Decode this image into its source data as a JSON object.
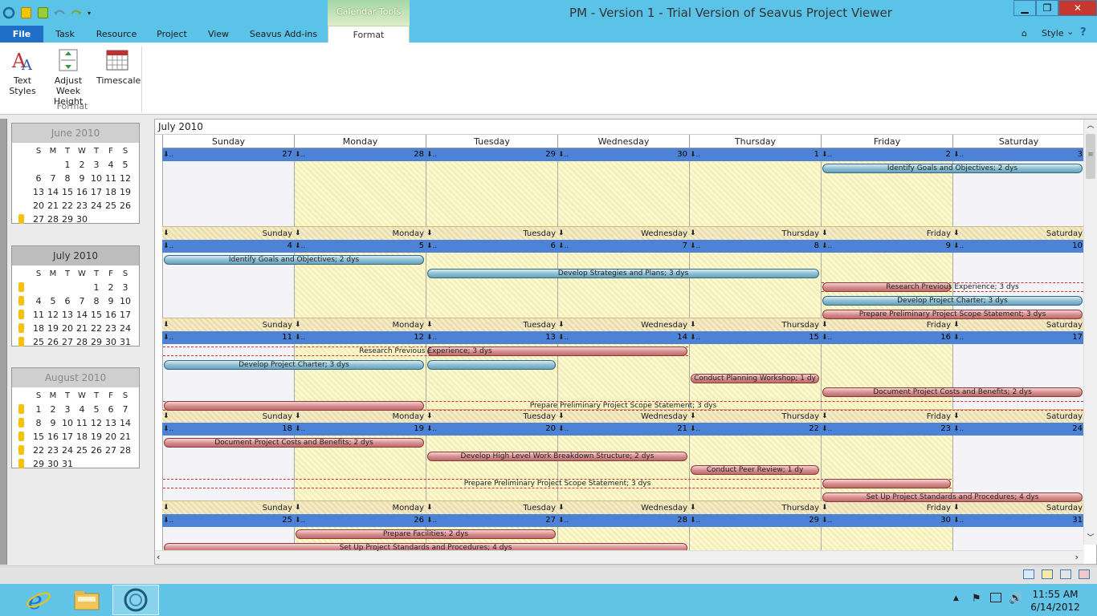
{
  "window": {
    "title": "PM - Version 1 - Trial Version of Seavus Project Viewer",
    "context_tab_group": "Calendar Tools",
    "minimize_glyph": "▁",
    "restore_glyph": "❐",
    "close_glyph": "✕"
  },
  "ribbon": {
    "tabs": [
      "File",
      "Task",
      "Resource",
      "Project",
      "View",
      "Seavus Add-ins",
      "Format"
    ],
    "style_label": "Style",
    "style_caret": "⌄",
    "help_glyph": "?",
    "buttons": [
      {
        "label": "Text Styles",
        "icon": "text-styles-icon"
      },
      {
        "label": "Adjust Week Height",
        "icon": "adjust-week-height-icon"
      },
      {
        "label": "Timescale",
        "icon": "timescale-icon"
      }
    ],
    "group_label": "Format"
  },
  "mini_calendars": {
    "day_headers": [
      "S",
      "M",
      "T",
      "W",
      "T",
      "F",
      "S"
    ],
    "months": [
      {
        "title": "June 2010",
        "current": false,
        "lead": 2,
        "days": 30
      },
      {
        "title": "July 2010",
        "current": true,
        "lead": 4,
        "days": 31
      },
      {
        "title": "August 2010",
        "current": false,
        "lead": 0,
        "days": 31
      }
    ]
  },
  "calendar": {
    "month_label": "July 2010",
    "day_names": [
      "Sunday",
      "Monday",
      "Tuesday",
      "Wednesday",
      "Thursday",
      "Friday",
      "Saturday"
    ],
    "weeks": [
      {
        "dates": [
          "27",
          "28",
          "29",
          "30",
          "1",
          "2",
          "3"
        ],
        "tasks": [
          {
            "name": "Identify Goals and Objectives; 2 dys",
            "start": 5,
            "span": 2,
            "row": 0,
            "style": "blue"
          }
        ]
      },
      {
        "dates": [
          "4",
          "5",
          "6",
          "7",
          "8",
          "9",
          "10"
        ],
        "tasks": [
          {
            "name": "Identify Goals and Objectives; 2 dys",
            "start": 0,
            "span": 2,
            "row": 0,
            "style": "blue"
          },
          {
            "name": "Develop Strategies and Plans; 3 dys",
            "start": 2,
            "span": 3,
            "row": 1,
            "style": "blue"
          },
          {
            "name": "Research Previous Experience; 3 dys",
            "start": 5,
            "span": 1,
            "row": 2,
            "style": "red",
            "dash_span": 2
          },
          {
            "name": "Develop Project Charter; 3 dys",
            "start": 5,
            "span": 2,
            "row": 3,
            "style": "blue"
          },
          {
            "name": "Prepare Preliminary Project Scope Statement; 3 dys",
            "start": 5,
            "span": 2,
            "row": 4,
            "style": "red"
          }
        ]
      },
      {
        "dates": [
          "11",
          "12",
          "13",
          "14",
          "15",
          "16",
          "17"
        ],
        "tasks": [
          {
            "name": "Research Previous Experience; 3 dys",
            "start": 2,
            "span": 2,
            "row": 0,
            "style": "red",
            "dash_from": 0
          },
          {
            "name": "Develop Project Charter; 3 dys",
            "start": 0,
            "span": 2,
            "row": 1,
            "style": "blue",
            "extra_start": 2,
            "extra_span": 1
          },
          {
            "name": "Conduct Planning Workshop; 1 dy",
            "start": 4,
            "span": 1,
            "row": 2,
            "style": "red"
          },
          {
            "name": "Document Project Costs and Benefits; 2 dys",
            "start": 5,
            "span": 2,
            "row": 3,
            "style": "red"
          },
          {
            "name": "Prepare Preliminary Project Scope Statement; 3 dys",
            "start": 0,
            "span": 2,
            "row": 4,
            "style": "red",
            "dash_span": 7
          }
        ]
      },
      {
        "dates": [
          "18",
          "19",
          "20",
          "21",
          "22",
          "23",
          "24"
        ],
        "tasks": [
          {
            "name": "Document Project Costs and Benefits; 2 dys",
            "start": 0,
            "span": 2,
            "row": 0,
            "style": "red"
          },
          {
            "name": "Develop High Level Work Breakdown Structure; 2 dys",
            "start": 2,
            "span": 2,
            "row": 1,
            "style": "red"
          },
          {
            "name": "Conduct Peer Review; 1 dy",
            "start": 4,
            "span": 1,
            "row": 2,
            "style": "red"
          },
          {
            "name": "Prepare Preliminary Project Scope Statement; 3 dys",
            "start": 5,
            "span": 1,
            "row": 3,
            "style": "red",
            "dash_from": 0
          },
          {
            "name": "Set Up Project Standards and Procedures; 4 dys",
            "start": 5,
            "span": 2,
            "row": 4,
            "style": "red"
          }
        ]
      },
      {
        "dates": [
          "25",
          "26",
          "27",
          "28",
          "29",
          "30",
          "31"
        ],
        "tasks": [
          {
            "name": "Prepare Facilities; 2 dys",
            "start": 1,
            "span": 2,
            "row": 0,
            "style": "red"
          },
          {
            "name": "Set Up Project Standards and Procedures; 4 dys",
            "start": 0,
            "span": 4,
            "row": 1,
            "style": "red"
          }
        ]
      }
    ]
  },
  "taskbar": {
    "time": "11:55 AM",
    "date": "6/14/2012"
  }
}
